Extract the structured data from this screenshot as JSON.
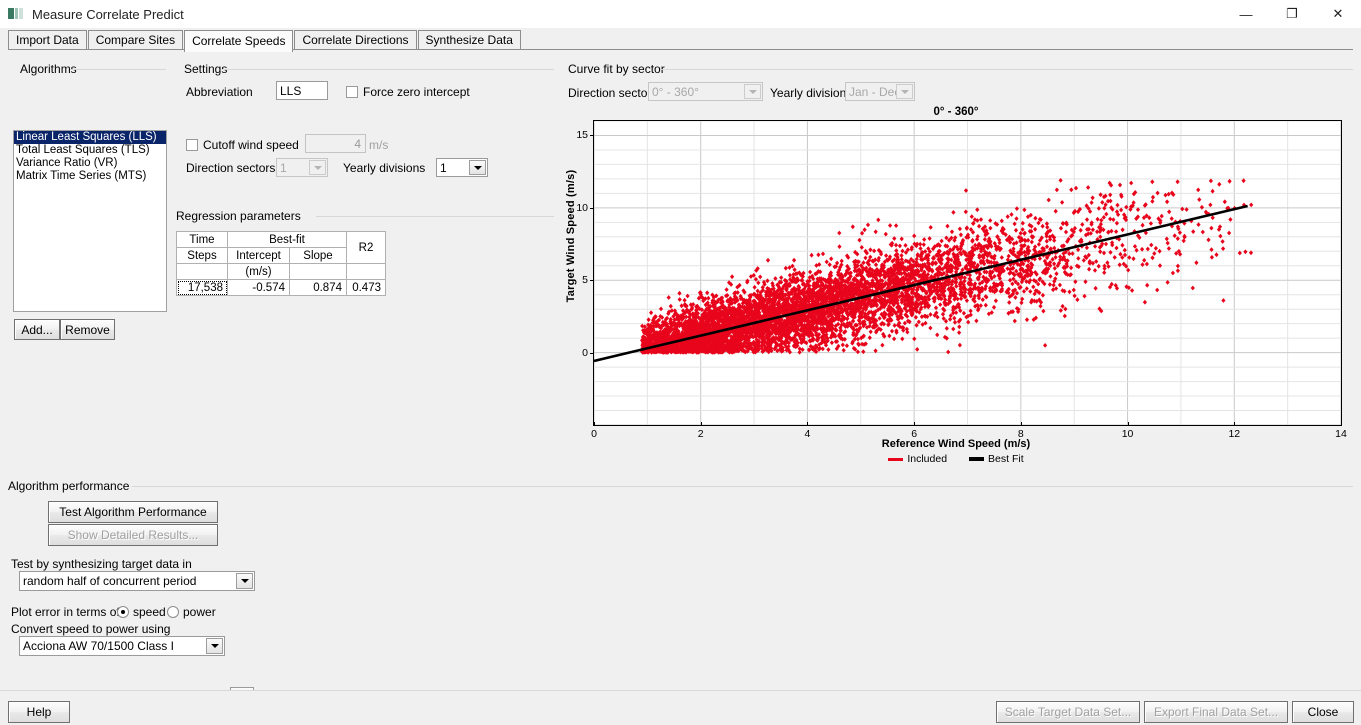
{
  "window": {
    "title": "Measure Correlate Predict",
    "icon": "app-icon",
    "minimize": "—",
    "maximize": "❐",
    "close": "✕"
  },
  "tabs": [
    {
      "label": "Import Data",
      "selected": false
    },
    {
      "label": "Compare Sites",
      "selected": false
    },
    {
      "label": "Correlate Speeds",
      "selected": true
    },
    {
      "label": "Correlate Directions",
      "selected": false
    },
    {
      "label": "Synthesize Data",
      "selected": false
    }
  ],
  "algorithms": {
    "group_title": "Algorithms",
    "items": [
      {
        "label": "Linear Least Squares (LLS)",
        "selected": true
      },
      {
        "label": "Total Least Squares (TLS)",
        "selected": false
      },
      {
        "label": "Variance Ratio (VR)",
        "selected": false
      },
      {
        "label": "Matrix Time Series (MTS)",
        "selected": false
      }
    ],
    "add_label": "Add...",
    "remove_label": "Remove"
  },
  "settings": {
    "group_title": "Settings",
    "abbreviation_label": "Abbreviation",
    "abbreviation_value": "LLS",
    "force_zero_intercept_label": "Force zero intercept",
    "force_zero_intercept_checked": false,
    "direction_sectors_label": "Direction sectors",
    "direction_sectors_value": "1",
    "yearly_divisions_label": "Yearly divisions",
    "yearly_divisions_value": "1",
    "cutoff_wind_speed_label": "Cutoff wind speed",
    "cutoff_wind_speed_checked": false,
    "cutoff_wind_speed_value": "4",
    "cutoff_units": "m/s"
  },
  "regression": {
    "group_title": "Regression parameters",
    "headers_row1": [
      "Time",
      "Best-fit",
      "R2"
    ],
    "headers_row2": [
      "Steps",
      "Intercept",
      "Slope"
    ],
    "headers_row3": [
      "",
      "(m/s)",
      ""
    ],
    "values": {
      "time_steps": "17,538",
      "intercept": "-0.574",
      "slope": "0.874",
      "r2": "0.473"
    }
  },
  "curve_fit": {
    "group_title": "Curve fit by sector",
    "direction_sector_label": "Direction sector",
    "direction_sector_value": "0° - 360°",
    "yearly_division_label": "Yearly division",
    "yearly_division_value": "Jan - Dec"
  },
  "algorithm_performance": {
    "group_title": "Algorithm performance",
    "test_button": "Test Algorithm Performance",
    "detailed_button": "Show Detailed Results...",
    "detailed_enabled": false,
    "synth_label": "Test by synthesizing target data in",
    "synth_value": "random half of concurrent period",
    "plot_error_label": "Plot error in terms of",
    "radio_speed": "speed",
    "radio_power": "power",
    "radio_selected": "speed",
    "convert_label": "Convert speed to power using",
    "convert_value": "Acciona AW 70/1500 Class I",
    "browse_icon": "open-file-icon"
  },
  "footer": {
    "help": "Help",
    "scale_target": "Scale Target Data Set...",
    "scale_target_enabled": false,
    "export_final": "Export Final Data Set...",
    "export_final_enabled": false,
    "close": "Close"
  },
  "colors": {
    "scatter": "#e8051c",
    "bestfit": "#000000",
    "selection": "#0a246a",
    "window_bg": "#f0f0f0"
  },
  "chart_data": {
    "type": "scatter",
    "title": "0° - 360°",
    "xlabel": "Reference Wind Speed (m/s)",
    "ylabel": "Target Wind Speed (m/s)",
    "xlim": [
      0,
      14
    ],
    "ylim": [
      -5,
      16
    ],
    "xticks": [
      0,
      2,
      4,
      6,
      8,
      10,
      12,
      14
    ],
    "yticks": [
      0,
      5,
      10,
      15
    ],
    "grid": true,
    "legend": [
      {
        "name": "Included",
        "color": "#e8051c",
        "marker": "diamond"
      },
      {
        "name": "Best Fit",
        "color": "#000000",
        "marker": "line"
      }
    ],
    "series": [
      {
        "name": "Included",
        "type": "scatter",
        "color": "#e8051c",
        "n_points": 17538,
        "x_range": [
          0.9,
          12.4
        ],
        "y_range": [
          0.0,
          11.9
        ],
        "description": "Dense cloud of red diamond markers rising from lower-left to upper-right, widening with increasing reference wind speed"
      },
      {
        "name": "Best Fit",
        "type": "line",
        "color": "#000000",
        "intercept": -0.574,
        "slope": 0.874,
        "r2": 0.473,
        "x_from": 0.0,
        "x_to": 12.25,
        "y_from": -0.574,
        "y_to": 10.13
      }
    ]
  }
}
